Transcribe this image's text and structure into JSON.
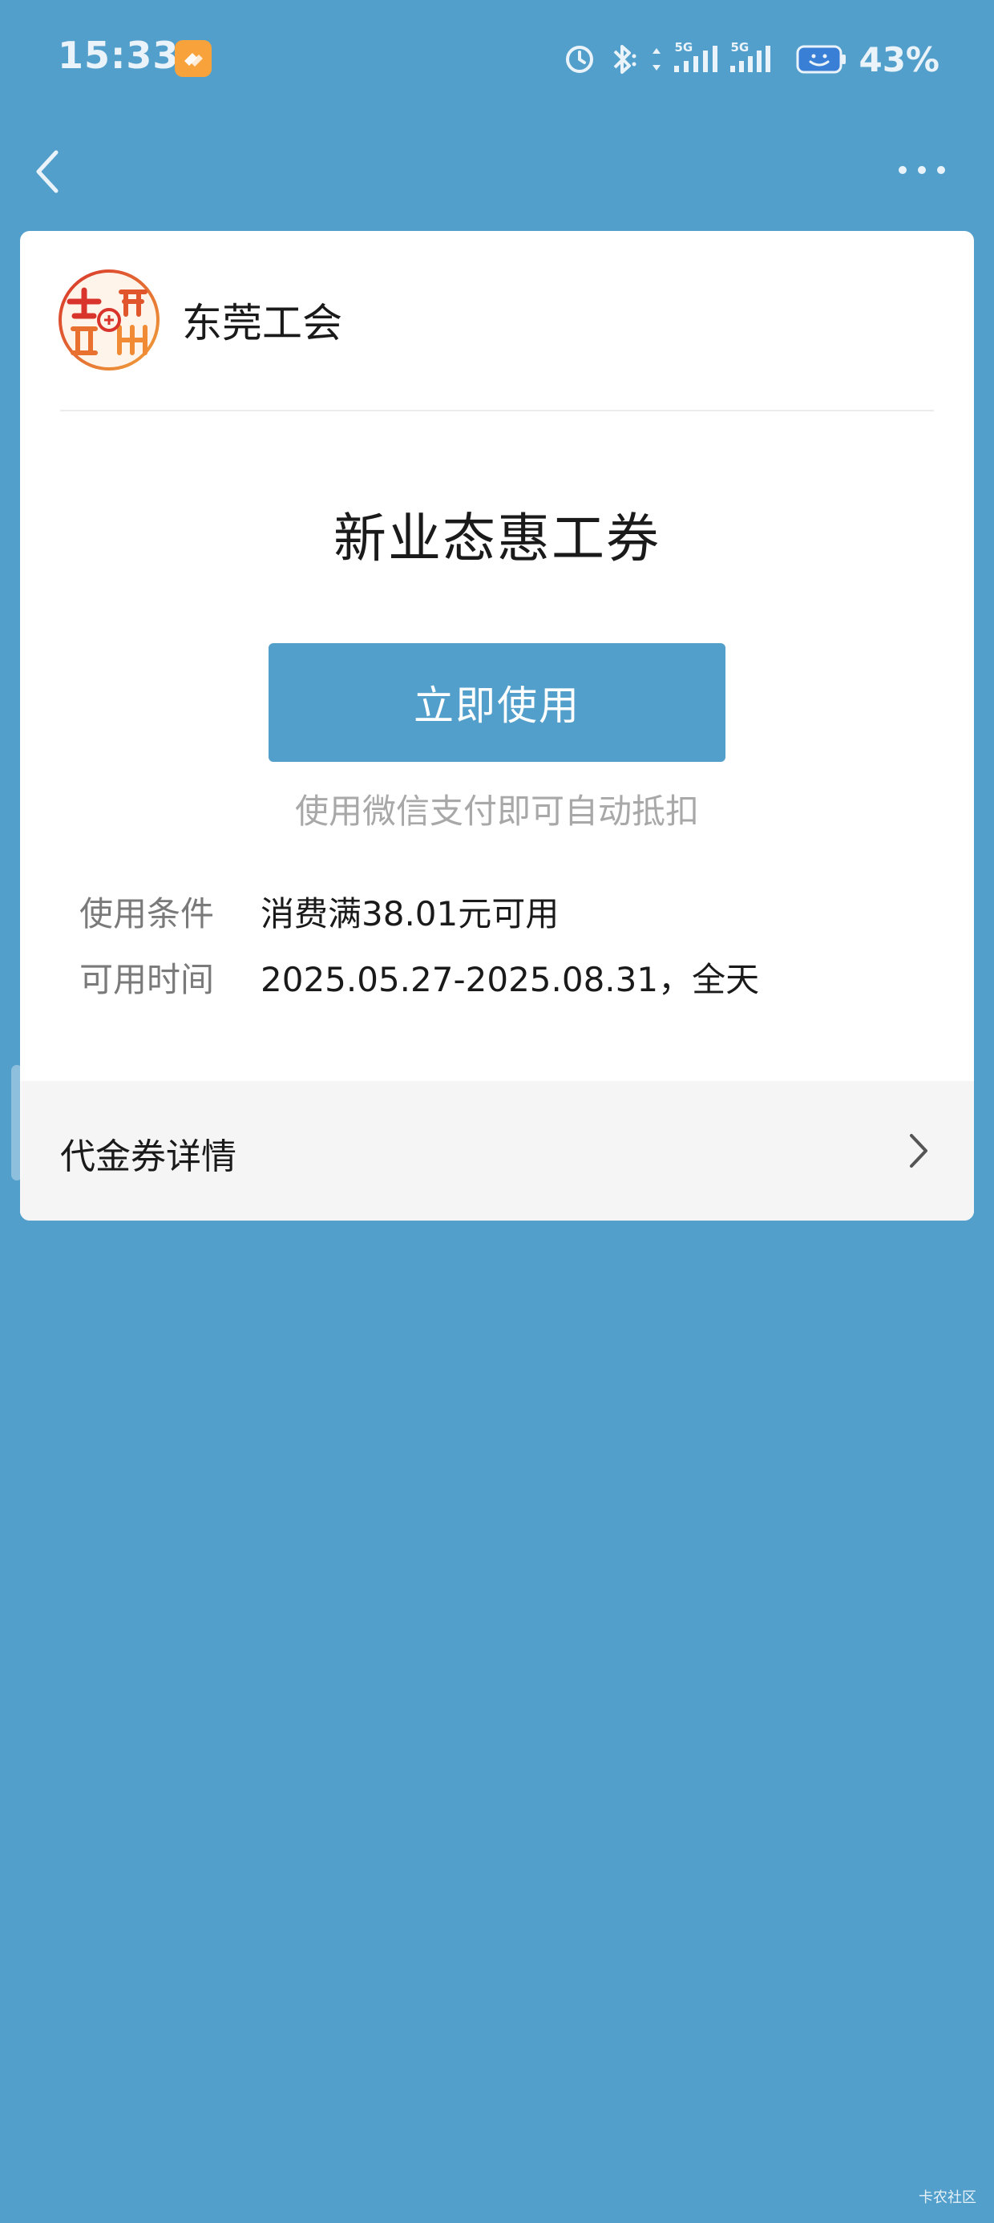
{
  "status_bar": {
    "time": "15:33",
    "network_label_1": "5G",
    "network_label_2": "5G",
    "battery": "43%",
    "icons": [
      "app-notification-icon",
      "alarm-icon",
      "bluetooth-icon",
      "data-transfer-icon",
      "signal-icon",
      "battery-icon"
    ]
  },
  "nav": {
    "back_icon": "chevron-left-icon",
    "more_icon": "more-dots-icon"
  },
  "merchant": {
    "name": "东莞工会",
    "logo_icon": "union-logo"
  },
  "coupon": {
    "title": "新业态惠工券",
    "use_button_label": "立即使用",
    "use_hint": "使用微信支付即可自动抵扣",
    "condition_label": "使用条件",
    "condition_value": "消费满38.01元可用",
    "time_label": "可用时间",
    "time_value": "2025.05.27-2025.08.31，全天"
  },
  "details": {
    "label": "代金券详情",
    "chevron_icon": "chevron-right-icon"
  },
  "watermark": "卡农社区",
  "colors": {
    "page_background": "#529fcb",
    "accent": "#529fcb",
    "card_background": "#ffffff",
    "detail_background": "#f5f5f5"
  }
}
